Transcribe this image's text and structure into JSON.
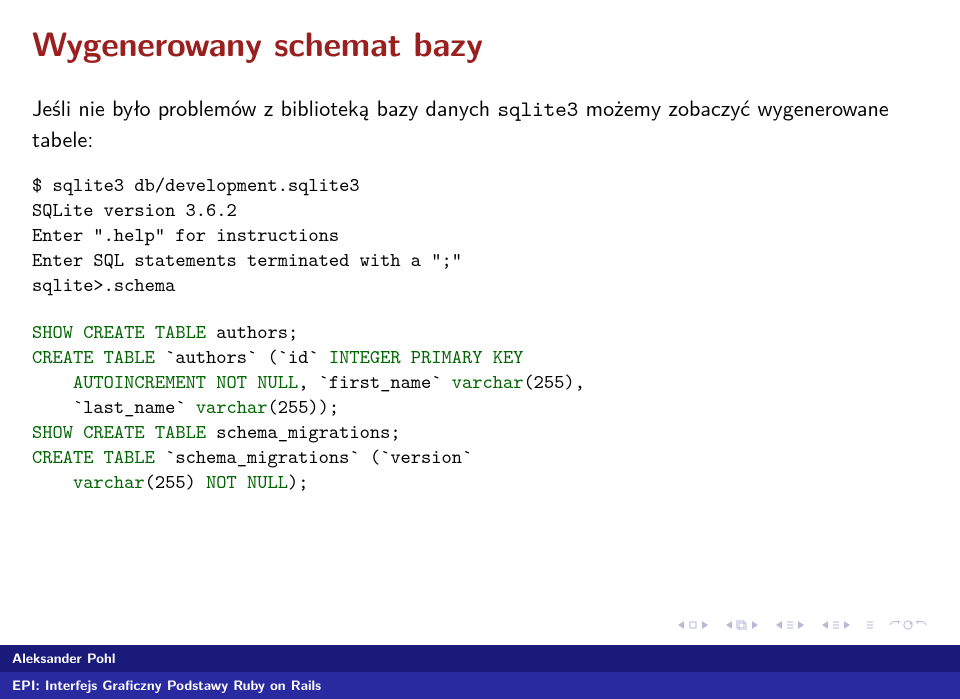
{
  "title": "Wygenerowany schemat bazy",
  "lead_before": "Jeśli nie było problemów z biblioteką bazy danych ",
  "lead_tt": "sqlite3",
  "lead_after": " możemy zobaczyć wygenerowane tabele:",
  "shell": {
    "l1": "$ sqlite3 db/development.sqlite3",
    "l2": "SQLite version 3.6.2",
    "l3": "Enter \".help\" for instructions",
    "l4": "Enter SQL statements terminated with a \";\"",
    "l5": "sqlite>.schema"
  },
  "code": {
    "r1a": "SHOW CREATE TABLE",
    "r1b": " authors;",
    "r2a": "CREATE TABLE",
    "r2b": " `authors` (`id` ",
    "r2c": "INTEGER PRIMARY KEY",
    "r3a": "    AUTOINCREMENT ",
    "r3b": "NOT NULL",
    "r3c": ", `first_name` ",
    "r3d": "varchar",
    "r3e": "(255),",
    "r4a": "    `last_name` ",
    "r4b": "varchar",
    "r4c": "(255));",
    "r5a": "SHOW CREATE TABLE",
    "r5b": " schema_migrations;",
    "r6a": "CREATE TABLE",
    "r6b": " `schema_migrations` (`version`",
    "r7a": "    ",
    "r7b": "varchar",
    "r7c": "(255) ",
    "r7d": "NOT NULL",
    "r7e": ");"
  },
  "footer": {
    "author": "Aleksander Pohl",
    "title": "EPI: Interfejs Graficzny Podstawy Ruby on Rails"
  }
}
